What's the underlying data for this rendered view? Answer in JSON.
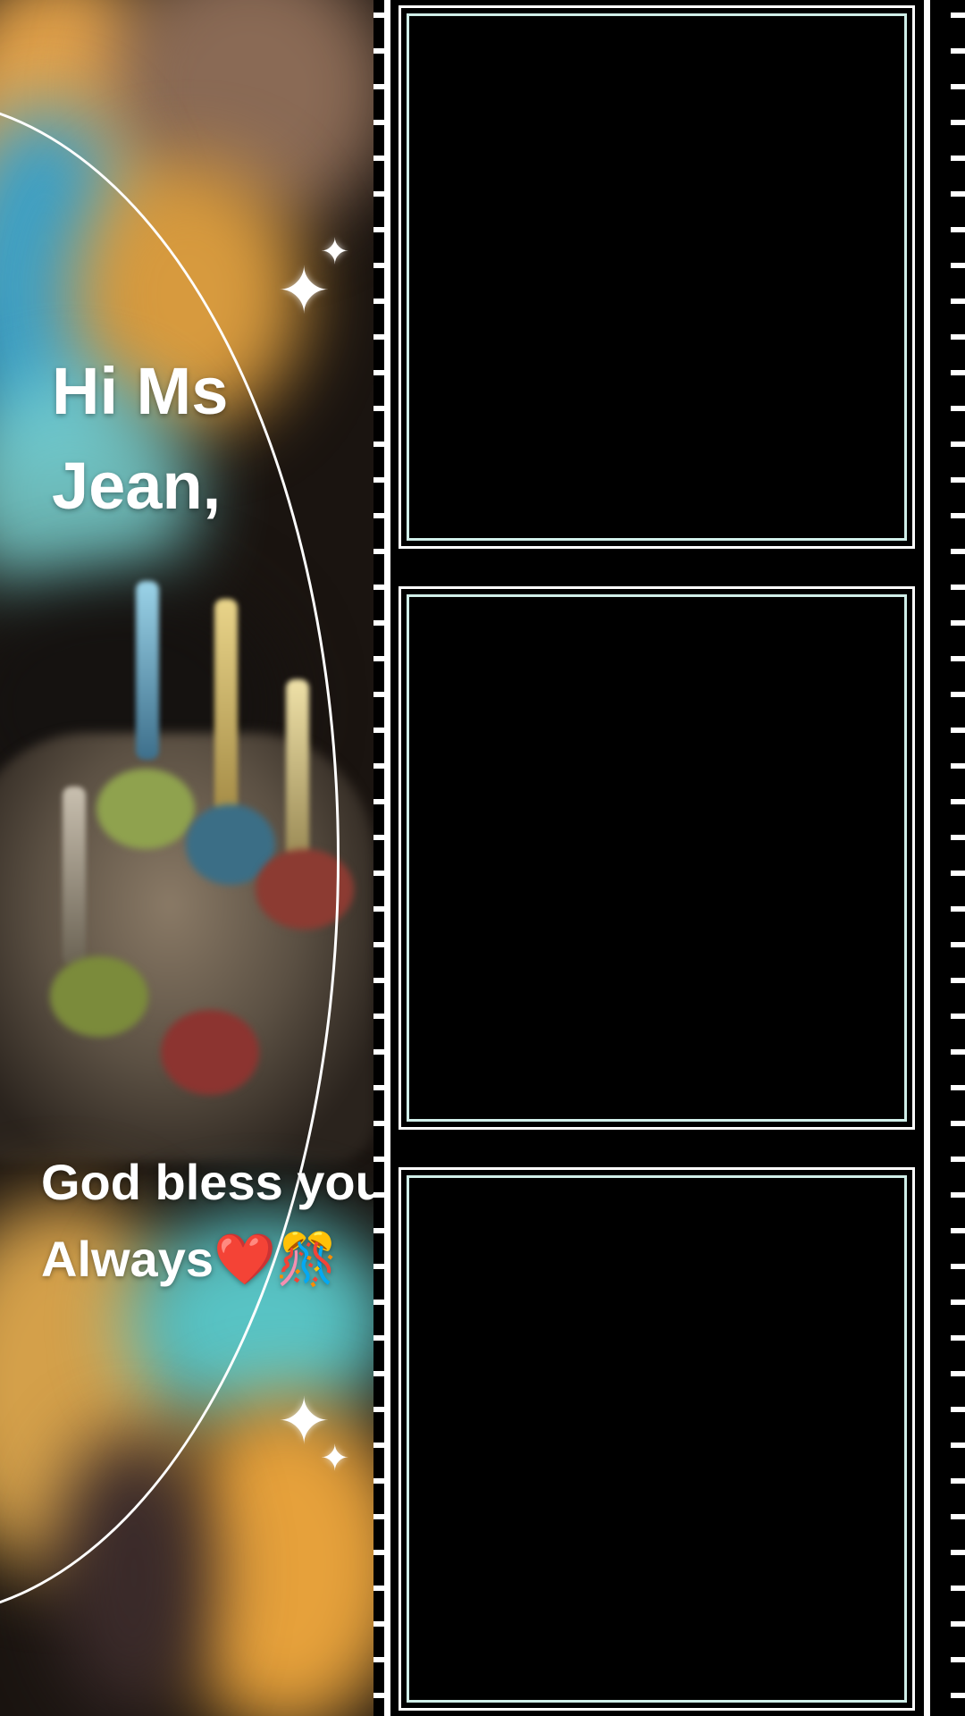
{
  "overlay": {
    "greeting": "Hi Ms Jean,",
    "blessing_line1": "God bless you",
    "blessing_line2": "Always❤️🎊"
  },
  "film_strip": {
    "frame_count": 3
  },
  "colors": {
    "frame_border": "#ffffff",
    "frame_inner_glow": "#cfeee8",
    "background": "#000000"
  },
  "icons": [
    "sparkle-icon",
    "sparkle-icon",
    "heart-icon",
    "confetti-icon"
  ]
}
